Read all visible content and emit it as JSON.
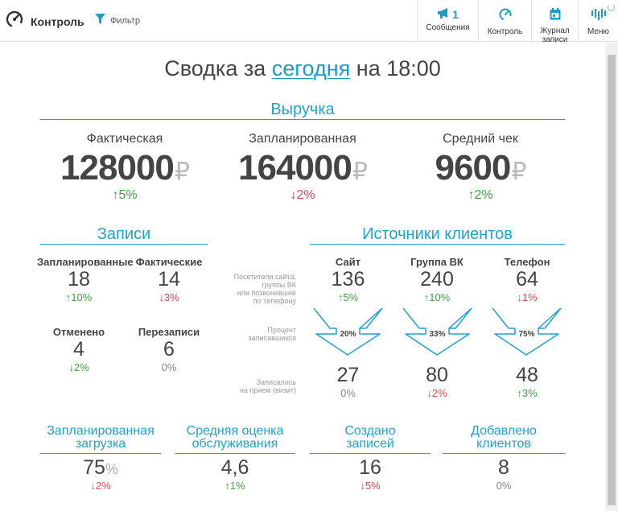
{
  "header": {
    "brand_label": "Контроль",
    "filter_label": "Фильтр",
    "nav": [
      {
        "label": "Сообщения",
        "badge": "1",
        "icon": "megaphone-icon"
      },
      {
        "label": "Контроль",
        "icon": "speedometer-icon"
      },
      {
        "label_line1": "Журнал",
        "label_line2": "записи",
        "icon": "calendar-icon"
      },
      {
        "label": "Меню",
        "icon": "menu-icon"
      }
    ]
  },
  "summary": {
    "prefix": "Сводка за",
    "period_link": "сегодня",
    "time_text": "на 18:00"
  },
  "revenue": {
    "heading": "Выручка",
    "currency": "₽",
    "items": [
      {
        "label": "Фактическая",
        "value": "128000",
        "change": "↑5%",
        "trend": "up"
      },
      {
        "label": "Запланированная",
        "value": "164000",
        "change": "↓2%",
        "trend": "down"
      },
      {
        "label": "Средний чек",
        "value": "9600",
        "change": "↑2%",
        "trend": "up"
      }
    ]
  },
  "appointments": {
    "heading": "Записи",
    "items": [
      {
        "label": "Запланированные",
        "value": "18",
        "change": "↑10%",
        "trend": "up"
      },
      {
        "label": "Фактические",
        "value": "14",
        "change": "↓3%",
        "trend": "down"
      },
      {
        "label": "Отменено",
        "value": "4",
        "change": "↓2%",
        "trend": "up"
      },
      {
        "label": "Перезаписи",
        "value": "6",
        "change": "0%",
        "trend": "neutral"
      }
    ]
  },
  "sources": {
    "heading": "Источники клиентов",
    "row_labels": {
      "visitors": [
        "Посетители сайта,",
        "группы ВК",
        "или позвонившие",
        "по телефону"
      ],
      "conversion": [
        "Процент",
        "записавшихся"
      ],
      "booked": [
        "Записались",
        "на прием (визит)"
      ]
    },
    "channels": [
      {
        "name": "Сайт",
        "visitors": "136",
        "visitors_change": "↑5%",
        "visitors_trend": "up",
        "conversion": "20%",
        "booked": "27",
        "booked_change": "0%",
        "booked_trend": "neutral"
      },
      {
        "name": "Группа ВК",
        "visitors": "240",
        "visitors_change": "↑10%",
        "visitors_trend": "up",
        "conversion": "33%",
        "booked": "80",
        "booked_change": "↓2%",
        "booked_trend": "down"
      },
      {
        "name": "Телефон",
        "visitors": "64",
        "visitors_change": "↓1%",
        "visitors_trend": "down",
        "conversion": "75%",
        "booked": "48",
        "booked_change": "↑3%",
        "booked_trend": "up"
      }
    ]
  },
  "bottom": [
    {
      "line1": "Запланированная",
      "line2": "загрузка",
      "value": "75",
      "unit": "%",
      "change": "↓2%",
      "trend": "down"
    },
    {
      "line1": "Средняя оценка",
      "line2": "обслуживания",
      "value": "4,6",
      "unit": "",
      "change": "↑1%",
      "trend": "up"
    },
    {
      "line1": "Создано",
      "line2": "записей",
      "value": "16",
      "unit": "",
      "change": "↓5%",
      "trend": "down"
    },
    {
      "line1": "Добавлено",
      "line2": "клиентов",
      "value": "8",
      "unit": "",
      "change": "0%",
      "trend": "neutral"
    }
  ],
  "colors": {
    "accent": "#1fa3d1",
    "up": "#3ea33e",
    "down": "#e24848",
    "neutral": "#888888"
  }
}
